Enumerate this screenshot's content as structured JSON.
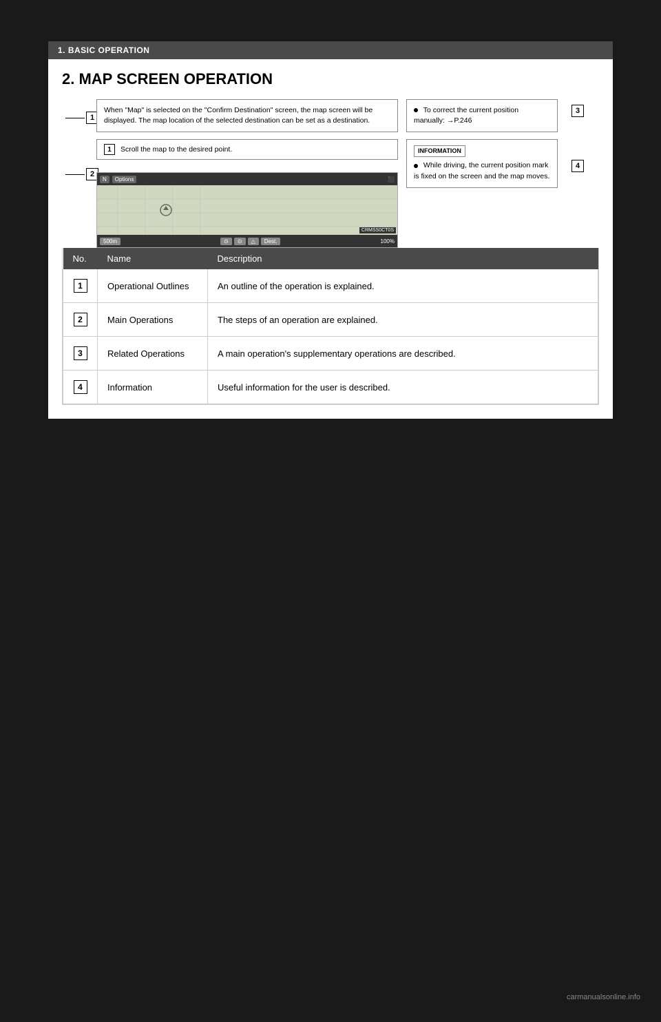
{
  "header": {
    "bar_text": "1. BASIC OPERATION"
  },
  "section": {
    "title": "2. MAP SCREEN OPERATION"
  },
  "diagram": {
    "callout1_text": "When \"Map\" is selected on the \"Confirm Destination\" screen, the map screen will be displayed. The map location of the selected destination can be set as a destination.",
    "step1_text": "Scroll the map to the desired point.",
    "right_bullet1": "To correct the current position manually: →P.246",
    "info_label": "INFORMATION",
    "info_bullet1": "While driving, the current position mark is fixed on the screen and the map moves.",
    "label1": "1",
    "label2": "2",
    "label3": "3",
    "label4": "4"
  },
  "table": {
    "headers": [
      "No.",
      "Name",
      "Description"
    ],
    "rows": [
      {
        "num": "1",
        "name": "Operational Outlines",
        "description": "An outline of the operation is explained."
      },
      {
        "num": "2",
        "name": "Main Operations",
        "description": "The steps of an operation are explained."
      },
      {
        "num": "3",
        "name": "Related Operations",
        "description": "A main operation's supplementary operations are described."
      },
      {
        "num": "4",
        "name": "Information",
        "description": "Useful information for the user is described."
      }
    ]
  },
  "footer": {
    "watermark": "carmanualsonline.info"
  }
}
